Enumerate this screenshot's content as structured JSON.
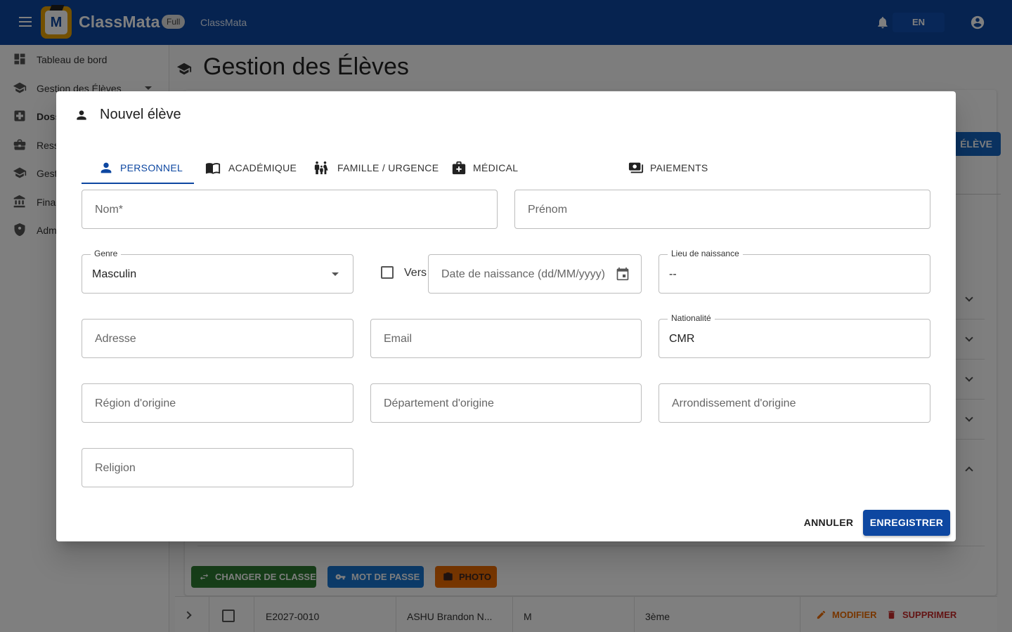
{
  "appbar": {
    "brand": "ClassMata",
    "badge": "Full",
    "subtitle": "ClassMata",
    "language": "EN",
    "icons": {
      "menu": "menu-icon",
      "bell": "bell-icon",
      "account": "account-icon"
    }
  },
  "sidebar": {
    "items": [
      {
        "label": "Tableau de bord",
        "icon": "dashboard-icon"
      },
      {
        "label": "Gestion des Élèves",
        "icon": "school-icon"
      },
      {
        "label": "Doss",
        "icon": "medical-icon"
      },
      {
        "label": "Ress",
        "icon": "briefcase-icon"
      },
      {
        "label": "Gest",
        "icon": "school-icon"
      },
      {
        "label": "Fina",
        "icon": "bank-icon"
      },
      {
        "label": "Adm",
        "icon": "admin-icon"
      }
    ]
  },
  "page": {
    "title": "Gestion des Élèves",
    "add_button": "ÉLÈVE",
    "actions": {
      "change_class": "CHANGER DE CLASSE",
      "password": "MOT DE PASSE",
      "photo": "PHOTO"
    },
    "row": {
      "id": "E2027-0010",
      "name": "ASHU Brandon N...",
      "gender": "M",
      "class": "3ème",
      "edit": "MODIFIER",
      "delete": "SUPPRIMER"
    }
  },
  "dialog": {
    "title": "Nouvel élève",
    "tabs": [
      {
        "label": "PERSONNEL",
        "icon": "person-icon",
        "active": true
      },
      {
        "label": "ACADÉMIQUE",
        "icon": "book-icon",
        "active": false
      },
      {
        "label": "FAMILLE / URGENCE",
        "icon": "family-icon",
        "active": false
      },
      {
        "label": "MÉDICAL",
        "icon": "medical-kit-icon",
        "active": false
      },
      {
        "label": "PAIEMENTS",
        "icon": "payments-icon",
        "active": false
      }
    ],
    "fields": {
      "nom": {
        "placeholder": "Nom*",
        "value": ""
      },
      "prenom": {
        "placeholder": "Prénom",
        "value": ""
      },
      "genre": {
        "label": "Genre",
        "value": "Masculin"
      },
      "vers": {
        "label": "Vers",
        "checked": false
      },
      "date_naissance": {
        "placeholder": "Date de naissance (dd/MM/yyyy)",
        "value": ""
      },
      "lieu_naissance": {
        "label": "Lieu de naissance",
        "value": "--"
      },
      "adresse": {
        "placeholder": "Adresse",
        "value": ""
      },
      "email": {
        "placeholder": "Email",
        "value": ""
      },
      "nationalite": {
        "label": "Nationalité",
        "value": "CMR"
      },
      "region": {
        "placeholder": "Région d'origine",
        "value": ""
      },
      "departement": {
        "placeholder": "Département d'origine",
        "value": ""
      },
      "arrondissement": {
        "placeholder": "Arrondissement d'origine",
        "value": ""
      },
      "religion": {
        "placeholder": "Religion",
        "value": ""
      }
    },
    "buttons": {
      "cancel": "ANNULER",
      "save": "ENREGISTRER"
    }
  },
  "colors": {
    "primary": "#0d47a1",
    "accent": "#e6a100",
    "success": "#2e7d32",
    "info": "#1976d2",
    "warning": "#ef6c00",
    "danger": "#c62828"
  }
}
